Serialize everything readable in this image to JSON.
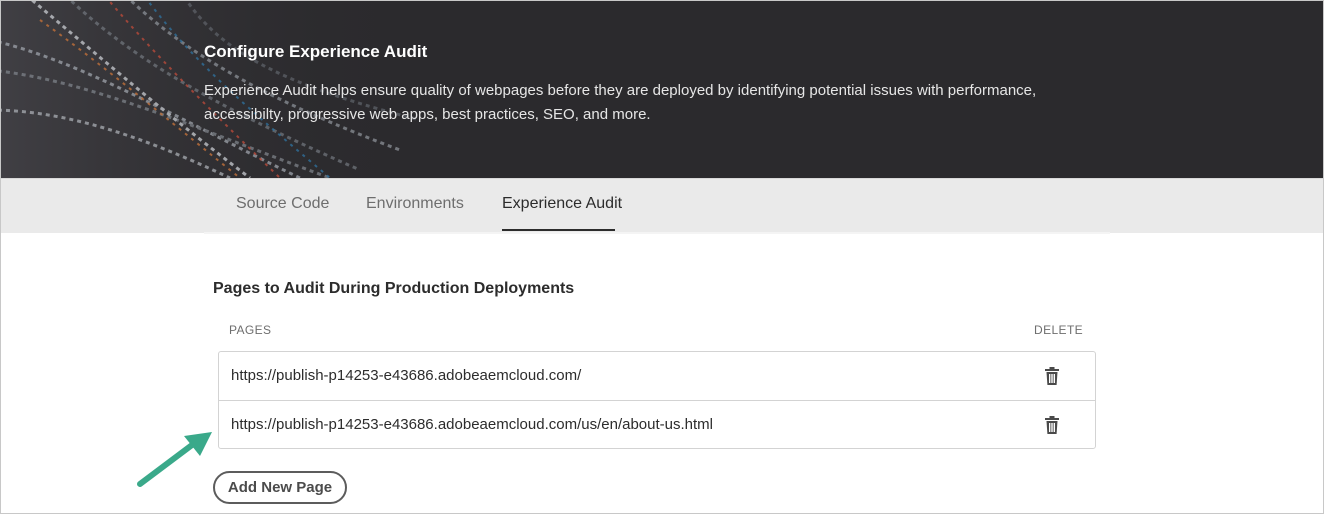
{
  "hero": {
    "title": "Configure Experience Audit",
    "description": "Experience Audit helps ensure quality of webpages before they are deployed by identifying potential issues with performance, accessibilty, progressive web apps, best practices, SEO, and more."
  },
  "tabs": [
    {
      "label": "Source Code",
      "active": false
    },
    {
      "label": "Environments",
      "active": false
    },
    {
      "label": "Experience Audit",
      "active": true
    }
  ],
  "section": {
    "title": "Pages to Audit During Production Deployments",
    "columns": {
      "pages": "PAGES",
      "delete": "DELETE"
    },
    "rows": [
      {
        "url": "https://publish-p14253-e43686.adobeaemcloud.com/",
        "icon": "trash-icon"
      },
      {
        "url": "https://publish-p14253-e43686.adobeaemcloud.com/us/en/about-us.html",
        "icon": "trash-icon"
      }
    ],
    "add_button": "Add New Page"
  },
  "colors": {
    "hero_bg": "#2b2a2d",
    "tabbar_bg": "#eaeaea",
    "annotation_arrow": "#3aa98a"
  }
}
